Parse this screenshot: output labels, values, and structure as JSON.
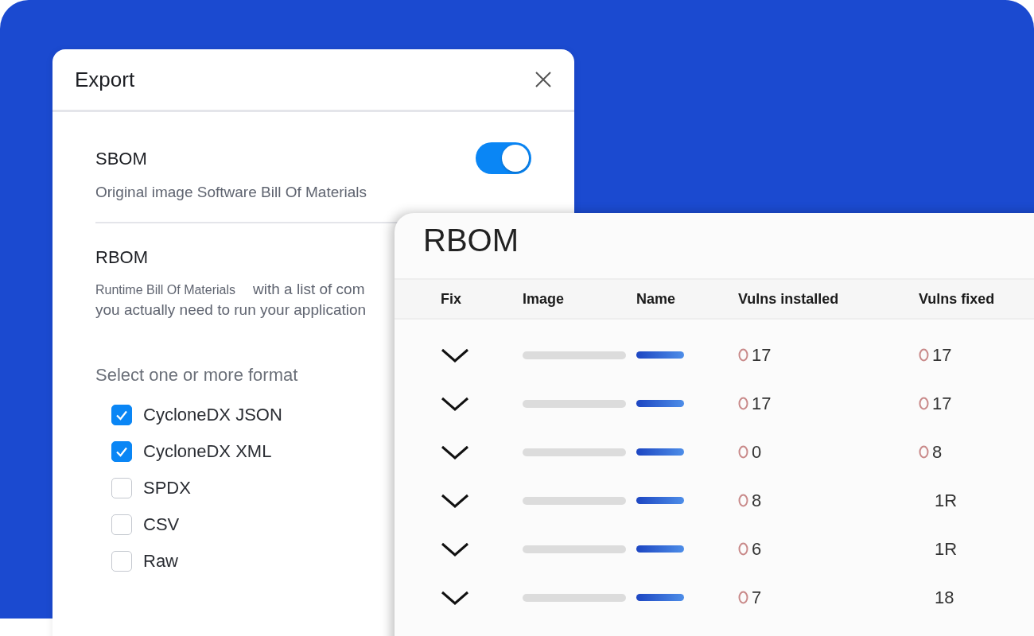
{
  "dialog": {
    "title": "Export",
    "sections": [
      {
        "title": "SBOM",
        "description": "Original image Software Bill Of Materials",
        "toggle": true
      },
      {
        "title": "RBOM",
        "description_small": "Runtime Bill Of Materials",
        "description_rest": "with a list of com",
        "description_line2": "you actually need to run your application"
      }
    ],
    "format_label": "Select one or more format",
    "formats": [
      {
        "label": "CycloneDX JSON",
        "checked": true
      },
      {
        "label": "CycloneDX XML",
        "checked": true
      },
      {
        "label": "SPDX",
        "checked": false
      },
      {
        "label": "CSV",
        "checked": false
      },
      {
        "label": "Raw",
        "checked": false
      }
    ]
  },
  "rbom_card": {
    "title": "RBOM",
    "columns": [
      "Fix",
      "Image",
      "Name",
      "Vulns installed",
      "Vulns fixed"
    ],
    "rows": [
      {
        "installed": {
          "value": "17",
          "circle": true
        },
        "fixed": {
          "value": "17",
          "circle": true
        }
      },
      {
        "installed": {
          "value": "17",
          "circle": true
        },
        "fixed": {
          "value": "17",
          "circle": true
        }
      },
      {
        "installed": {
          "value": "0",
          "circle": true
        },
        "fixed": {
          "value": "8",
          "circle": true
        }
      },
      {
        "installed": {
          "value": "8",
          "circle": true
        },
        "fixed": {
          "value": "1R",
          "circle": false
        }
      },
      {
        "installed": {
          "value": "6",
          "circle": true
        },
        "fixed": {
          "value": "1R",
          "circle": false
        }
      },
      {
        "installed": {
          "value": "7",
          "circle": true
        },
        "fixed": {
          "value": "18",
          "circle": false
        }
      }
    ]
  }
}
